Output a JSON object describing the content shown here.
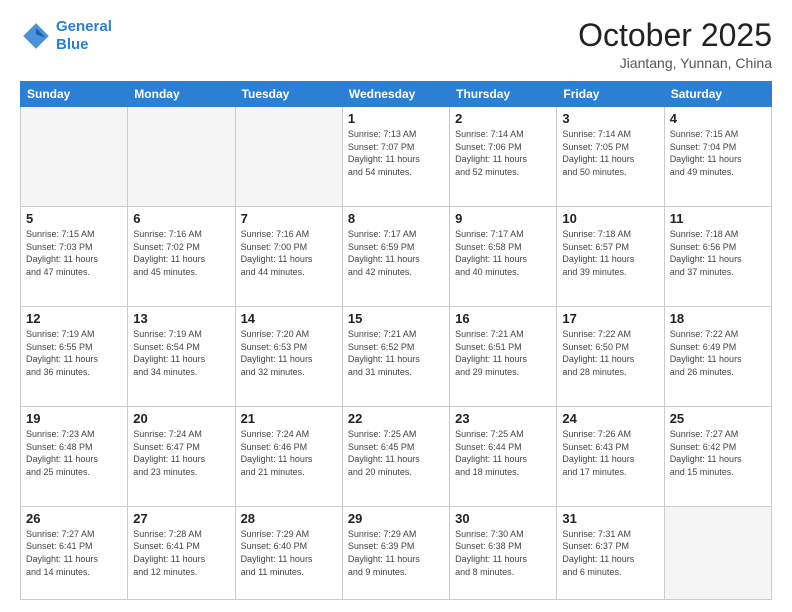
{
  "header": {
    "logo_line1": "General",
    "logo_line2": "Blue",
    "month": "October 2025",
    "location": "Jiantang, Yunnan, China"
  },
  "weekdays": [
    "Sunday",
    "Monday",
    "Tuesday",
    "Wednesday",
    "Thursday",
    "Friday",
    "Saturday"
  ],
  "weeks": [
    [
      {
        "day": "",
        "info": ""
      },
      {
        "day": "",
        "info": ""
      },
      {
        "day": "",
        "info": ""
      },
      {
        "day": "1",
        "info": "Sunrise: 7:13 AM\nSunset: 7:07 PM\nDaylight: 11 hours\nand 54 minutes."
      },
      {
        "day": "2",
        "info": "Sunrise: 7:14 AM\nSunset: 7:06 PM\nDaylight: 11 hours\nand 52 minutes."
      },
      {
        "day": "3",
        "info": "Sunrise: 7:14 AM\nSunset: 7:05 PM\nDaylight: 11 hours\nand 50 minutes."
      },
      {
        "day": "4",
        "info": "Sunrise: 7:15 AM\nSunset: 7:04 PM\nDaylight: 11 hours\nand 49 minutes."
      }
    ],
    [
      {
        "day": "5",
        "info": "Sunrise: 7:15 AM\nSunset: 7:03 PM\nDaylight: 11 hours\nand 47 minutes."
      },
      {
        "day": "6",
        "info": "Sunrise: 7:16 AM\nSunset: 7:02 PM\nDaylight: 11 hours\nand 45 minutes."
      },
      {
        "day": "7",
        "info": "Sunrise: 7:16 AM\nSunset: 7:00 PM\nDaylight: 11 hours\nand 44 minutes."
      },
      {
        "day": "8",
        "info": "Sunrise: 7:17 AM\nSunset: 6:59 PM\nDaylight: 11 hours\nand 42 minutes."
      },
      {
        "day": "9",
        "info": "Sunrise: 7:17 AM\nSunset: 6:58 PM\nDaylight: 11 hours\nand 40 minutes."
      },
      {
        "day": "10",
        "info": "Sunrise: 7:18 AM\nSunset: 6:57 PM\nDaylight: 11 hours\nand 39 minutes."
      },
      {
        "day": "11",
        "info": "Sunrise: 7:18 AM\nSunset: 6:56 PM\nDaylight: 11 hours\nand 37 minutes."
      }
    ],
    [
      {
        "day": "12",
        "info": "Sunrise: 7:19 AM\nSunset: 6:55 PM\nDaylight: 11 hours\nand 36 minutes."
      },
      {
        "day": "13",
        "info": "Sunrise: 7:19 AM\nSunset: 6:54 PM\nDaylight: 11 hours\nand 34 minutes."
      },
      {
        "day": "14",
        "info": "Sunrise: 7:20 AM\nSunset: 6:53 PM\nDaylight: 11 hours\nand 32 minutes."
      },
      {
        "day": "15",
        "info": "Sunrise: 7:21 AM\nSunset: 6:52 PM\nDaylight: 11 hours\nand 31 minutes."
      },
      {
        "day": "16",
        "info": "Sunrise: 7:21 AM\nSunset: 6:51 PM\nDaylight: 11 hours\nand 29 minutes."
      },
      {
        "day": "17",
        "info": "Sunrise: 7:22 AM\nSunset: 6:50 PM\nDaylight: 11 hours\nand 28 minutes."
      },
      {
        "day": "18",
        "info": "Sunrise: 7:22 AM\nSunset: 6:49 PM\nDaylight: 11 hours\nand 26 minutes."
      }
    ],
    [
      {
        "day": "19",
        "info": "Sunrise: 7:23 AM\nSunset: 6:48 PM\nDaylight: 11 hours\nand 25 minutes."
      },
      {
        "day": "20",
        "info": "Sunrise: 7:24 AM\nSunset: 6:47 PM\nDaylight: 11 hours\nand 23 minutes."
      },
      {
        "day": "21",
        "info": "Sunrise: 7:24 AM\nSunset: 6:46 PM\nDaylight: 11 hours\nand 21 minutes."
      },
      {
        "day": "22",
        "info": "Sunrise: 7:25 AM\nSunset: 6:45 PM\nDaylight: 11 hours\nand 20 minutes."
      },
      {
        "day": "23",
        "info": "Sunrise: 7:25 AM\nSunset: 6:44 PM\nDaylight: 11 hours\nand 18 minutes."
      },
      {
        "day": "24",
        "info": "Sunrise: 7:26 AM\nSunset: 6:43 PM\nDaylight: 11 hours\nand 17 minutes."
      },
      {
        "day": "25",
        "info": "Sunrise: 7:27 AM\nSunset: 6:42 PM\nDaylight: 11 hours\nand 15 minutes."
      }
    ],
    [
      {
        "day": "26",
        "info": "Sunrise: 7:27 AM\nSunset: 6:41 PM\nDaylight: 11 hours\nand 14 minutes."
      },
      {
        "day": "27",
        "info": "Sunrise: 7:28 AM\nSunset: 6:41 PM\nDaylight: 11 hours\nand 12 minutes."
      },
      {
        "day": "28",
        "info": "Sunrise: 7:29 AM\nSunset: 6:40 PM\nDaylight: 11 hours\nand 11 minutes."
      },
      {
        "day": "29",
        "info": "Sunrise: 7:29 AM\nSunset: 6:39 PM\nDaylight: 11 hours\nand 9 minutes."
      },
      {
        "day": "30",
        "info": "Sunrise: 7:30 AM\nSunset: 6:38 PM\nDaylight: 11 hours\nand 8 minutes."
      },
      {
        "day": "31",
        "info": "Sunrise: 7:31 AM\nSunset: 6:37 PM\nDaylight: 11 hours\nand 6 minutes."
      },
      {
        "day": "",
        "info": ""
      }
    ]
  ]
}
